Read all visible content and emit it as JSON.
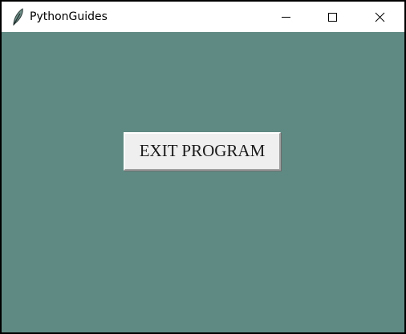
{
  "window": {
    "title": "PythonGuides",
    "icon": "tk-feather-icon"
  },
  "titlebar_controls": {
    "minimize": "minimize-icon",
    "maximize": "maximize-icon",
    "close": "close-icon"
  },
  "main": {
    "exit_label": "EXIT PROGRAM",
    "background_color": "#5f8a83",
    "button_color": "#efefef"
  }
}
